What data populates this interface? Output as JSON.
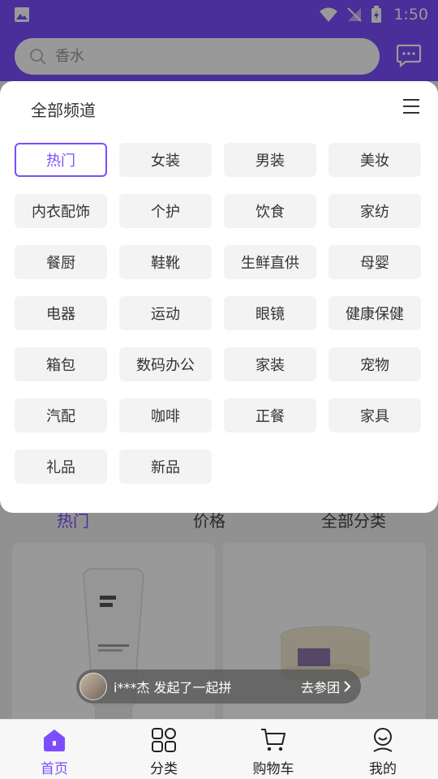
{
  "status_bar": {
    "time": "1:50"
  },
  "search": {
    "placeholder": "香水"
  },
  "channels": {
    "title": "全部频道",
    "items": [
      "热门",
      "女装",
      "男装",
      "美妆",
      "内衣配饰",
      "个护",
      "饮食",
      "家纺",
      "餐厨",
      "鞋靴",
      "生鲜直供",
      "母婴",
      "电器",
      "运动",
      "眼镜",
      "健康保健",
      "箱包",
      "数码办公",
      "家装",
      "宠物",
      "汽配",
      "咖啡",
      "正餐",
      "家具",
      "礼品",
      "新品"
    ],
    "active_index": 0
  },
  "sort_tabs": [
    "热门",
    "价格",
    "全部分类"
  ],
  "toast": {
    "message": "i***杰  发起了一起拼",
    "action": "去参团"
  },
  "bottom_nav": [
    {
      "label": "首页",
      "icon": "home-icon",
      "active": true
    },
    {
      "label": "分类",
      "icon": "category-icon",
      "active": false
    },
    {
      "label": "购物车",
      "icon": "cart-icon",
      "active": false
    },
    {
      "label": "我的",
      "icon": "profile-icon",
      "active": false
    }
  ],
  "colors": {
    "accent": "#7c4dff",
    "chip_bg": "#f3f3f3"
  }
}
